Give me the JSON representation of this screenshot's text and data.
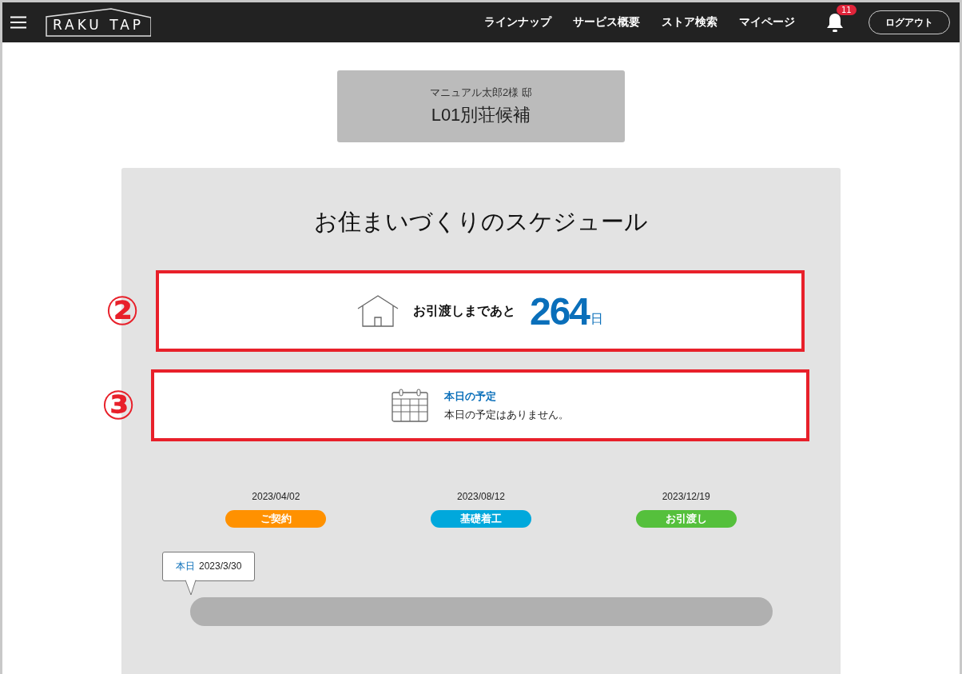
{
  "header": {
    "logo": "RAKU TAP",
    "nav": [
      "ラインナップ",
      "サービス概要",
      "ストア検索",
      "マイページ"
    ],
    "notification_count": "11",
    "logout": "ログアウト"
  },
  "property": {
    "owner": "マニュアル太郎2様 邸",
    "name": "L01別荘候補"
  },
  "schedule": {
    "title": "お住まいづくりのスケジュール",
    "countdown": {
      "marker": "②",
      "label": "お引渡しまであと",
      "days": "264",
      "unit": "日"
    },
    "today": {
      "marker": "③",
      "title": "本日の予定",
      "message": "本日の予定はありません。"
    },
    "milestones": [
      {
        "date": "2023/04/02",
        "label": "ご契約",
        "color": "#ff9100"
      },
      {
        "date": "2023/08/12",
        "label": "基礎着工",
        "color": "#00a8dc"
      },
      {
        "date": "2023/12/19",
        "label": "お引渡し",
        "color": "#55c03c"
      }
    ],
    "progress": {
      "today_label": "本日",
      "today_date": "2023/3/30",
      "level": 0
    }
  }
}
